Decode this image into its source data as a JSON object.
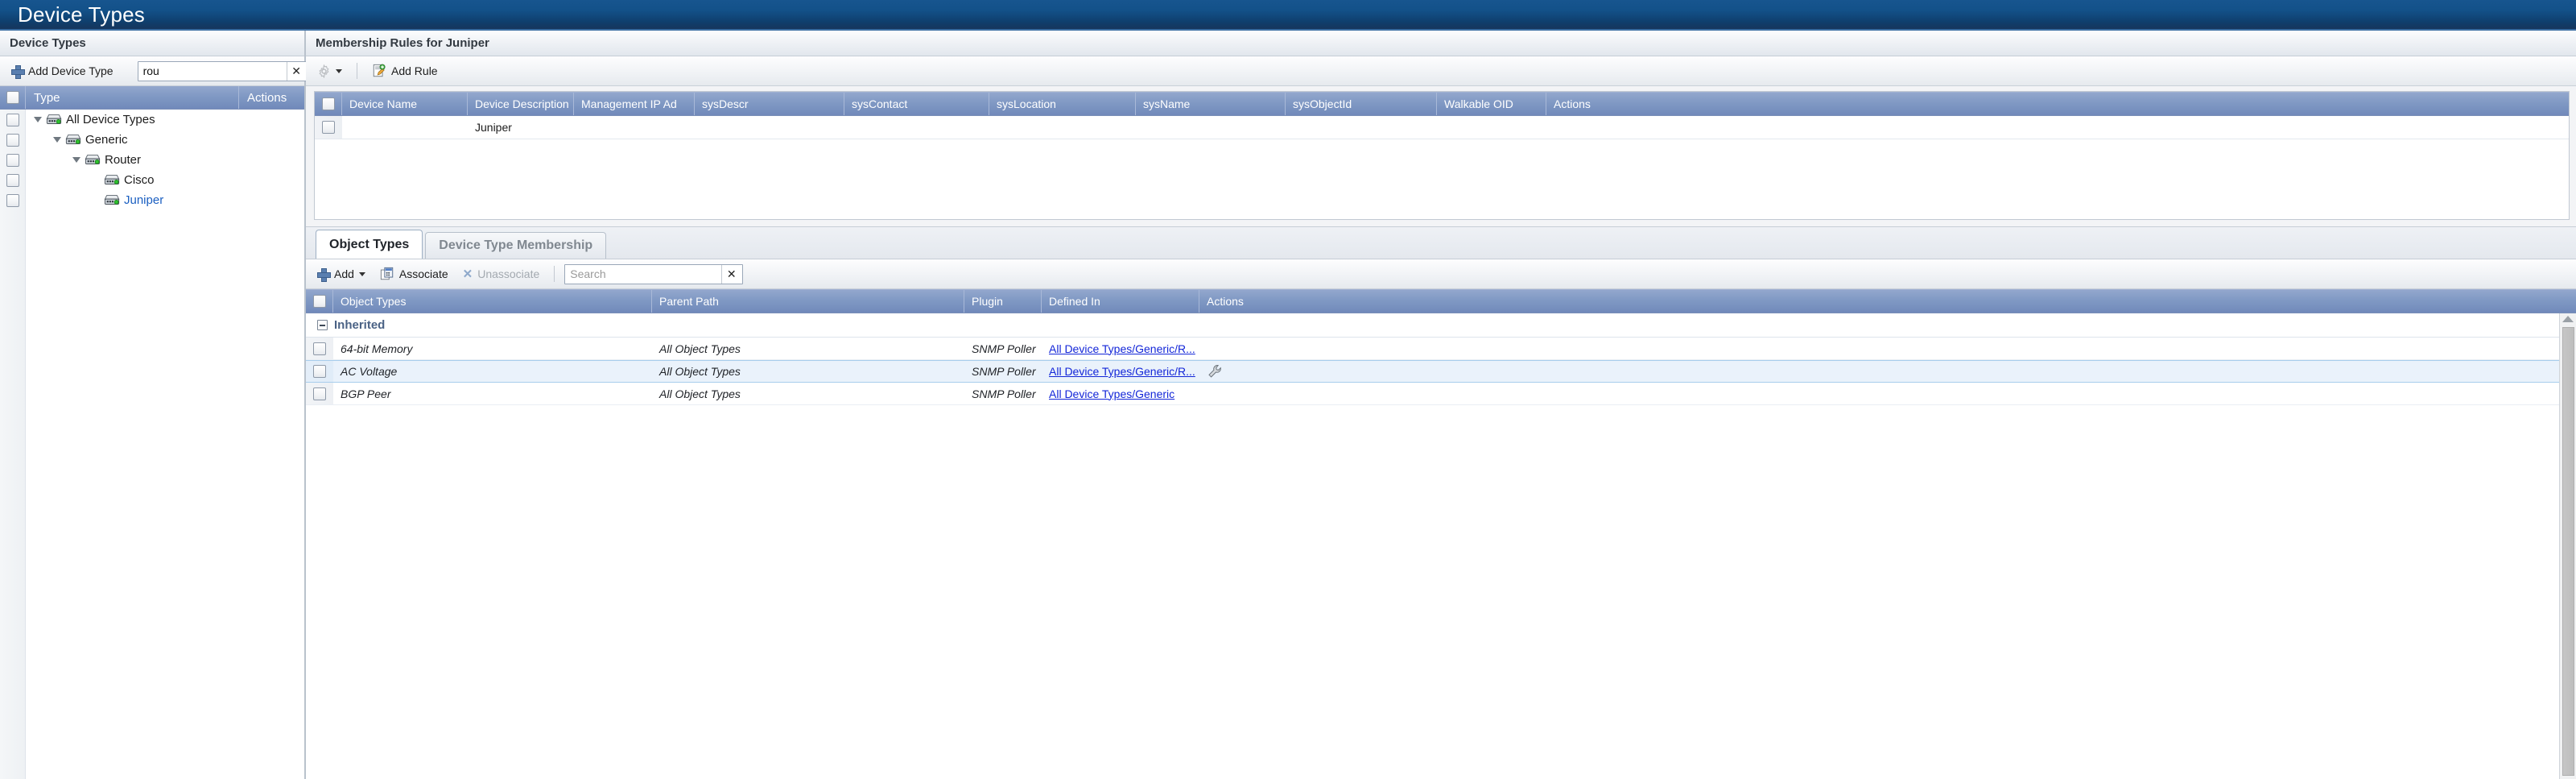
{
  "window": {
    "title": "Device Types"
  },
  "left_panel": {
    "header": "Device Types",
    "toolbar": {
      "add_label": "Add Device Type",
      "add_icon": "plus-icon",
      "search_value": "rou",
      "clear_label": "✕"
    },
    "grid": {
      "columns": [
        "Type",
        "Actions"
      ]
    },
    "tree": [
      {
        "label": "All Device Types",
        "depth": 0,
        "expanded": true,
        "selected": false,
        "icon": "device-icon"
      },
      {
        "label": "Generic",
        "depth": 1,
        "expanded": true,
        "selected": false,
        "icon": "device-icon"
      },
      {
        "label": "Router",
        "depth": 2,
        "expanded": true,
        "selected": false,
        "icon": "device-icon"
      },
      {
        "label": "Cisco",
        "depth": 3,
        "expanded": false,
        "selected": false,
        "icon": "device-icon"
      },
      {
        "label": "Juniper",
        "depth": 3,
        "expanded": false,
        "selected": true,
        "icon": "device-icon"
      }
    ]
  },
  "right_panel": {
    "header": "Membership Rules for Juniper",
    "toolbar": {
      "settings_icon": "gear-icon",
      "settings_caret": "chevron-down-icon",
      "add_rule_label": "Add Rule",
      "add_rule_icon": "add-rule-icon"
    },
    "rules_grid": {
      "columns": [
        "Device Name",
        "Device Description",
        "Management IP Ad",
        "sysDescr",
        "sysContact",
        "sysLocation",
        "sysName",
        "sysObjectId",
        "Walkable OID",
        "Actions"
      ],
      "rows": [
        {
          "device_name": "",
          "device_description": "Juniper",
          "management_ip": "",
          "sys_descr": "",
          "sys_contact": "",
          "sys_location": "",
          "sys_name": "",
          "sys_object_id": "",
          "walkable_oid": "",
          "actions": ""
        }
      ]
    },
    "tabs": [
      {
        "label": "Object Types",
        "active": true
      },
      {
        "label": "Device Type Membership",
        "active": false
      }
    ],
    "object_toolbar": {
      "add_label": "Add",
      "add_icon": "plus-icon",
      "add_caret": "chevron-down-icon",
      "associate_label": "Associate",
      "associate_icon": "associate-icon",
      "unassociate_label": "Unassociate",
      "unassociate_icon": "x-icon",
      "unassociate_disabled": true,
      "search_placeholder": "Search",
      "search_value": "",
      "clear_label": "✕"
    },
    "object_grid": {
      "columns": [
        "Object Types",
        "Parent Path",
        "Plugin",
        "Defined In",
        "Actions"
      ],
      "groups": [
        {
          "label": "Inherited",
          "expanded": true,
          "rows": [
            {
              "object_type": "64-bit Memory",
              "parent_path": "All Object Types",
              "plugin": "SNMP Poller",
              "defined_in": "All Device Types/Generic/R...",
              "action_icon": "",
              "hover": false
            },
            {
              "object_type": "AC Voltage",
              "parent_path": "All Object Types",
              "plugin": "SNMP Poller",
              "defined_in": "All Device Types/Generic/R...",
              "action_icon": "wrench-icon",
              "hover": true
            },
            {
              "object_type": "BGP Peer",
              "parent_path": "All Object Types",
              "plugin": "SNMP Poller",
              "defined_in": "All Device Types/Generic",
              "action_icon": "",
              "hover": false
            }
          ]
        }
      ]
    },
    "scrollbar": {
      "up_arrow": "scroll-up-icon"
    }
  },
  "colors": {
    "title_bar": "#13538c",
    "grid_header": "#8099c4",
    "link": "#1326d8",
    "selected_tree_text": "#1b5fc1",
    "group_label": "#4a6285",
    "hover_row": "#eaf2fb"
  }
}
